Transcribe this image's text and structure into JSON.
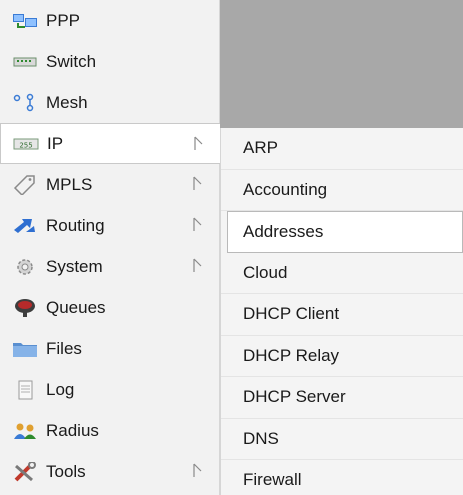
{
  "left_menu": {
    "items": [
      {
        "label": "PPP",
        "icon": "ppp-icon",
        "has_submenu": false
      },
      {
        "label": "Switch",
        "icon": "switch-icon",
        "has_submenu": false
      },
      {
        "label": "Mesh",
        "icon": "mesh-icon",
        "has_submenu": false
      },
      {
        "label": "IP",
        "icon": "ip-icon",
        "has_submenu": true
      },
      {
        "label": "MPLS",
        "icon": "mpls-icon",
        "has_submenu": true
      },
      {
        "label": "Routing",
        "icon": "routing-icon",
        "has_submenu": true
      },
      {
        "label": "System",
        "icon": "system-icon",
        "has_submenu": true
      },
      {
        "label": "Queues",
        "icon": "queues-icon",
        "has_submenu": false
      },
      {
        "label": "Files",
        "icon": "files-icon",
        "has_submenu": false
      },
      {
        "label": "Log",
        "icon": "log-icon",
        "has_submenu": false
      },
      {
        "label": "Radius",
        "icon": "radius-icon",
        "has_submenu": false
      },
      {
        "label": "Tools",
        "icon": "tools-icon",
        "has_submenu": true
      }
    ],
    "active": "IP"
  },
  "ip_submenu": {
    "items": [
      {
        "label": "ARP"
      },
      {
        "label": "Accounting"
      },
      {
        "label": "Addresses"
      },
      {
        "label": "Cloud"
      },
      {
        "label": "DHCP Client"
      },
      {
        "label": "DHCP Relay"
      },
      {
        "label": "DHCP Server"
      },
      {
        "label": "DNS"
      },
      {
        "label": "Firewall"
      }
    ],
    "highlighted": "Addresses"
  },
  "colors": {
    "backdrop": "#a8a8a8",
    "menu_bg": "#f2f2f2",
    "submenu_bg": "#f4f4f4"
  }
}
